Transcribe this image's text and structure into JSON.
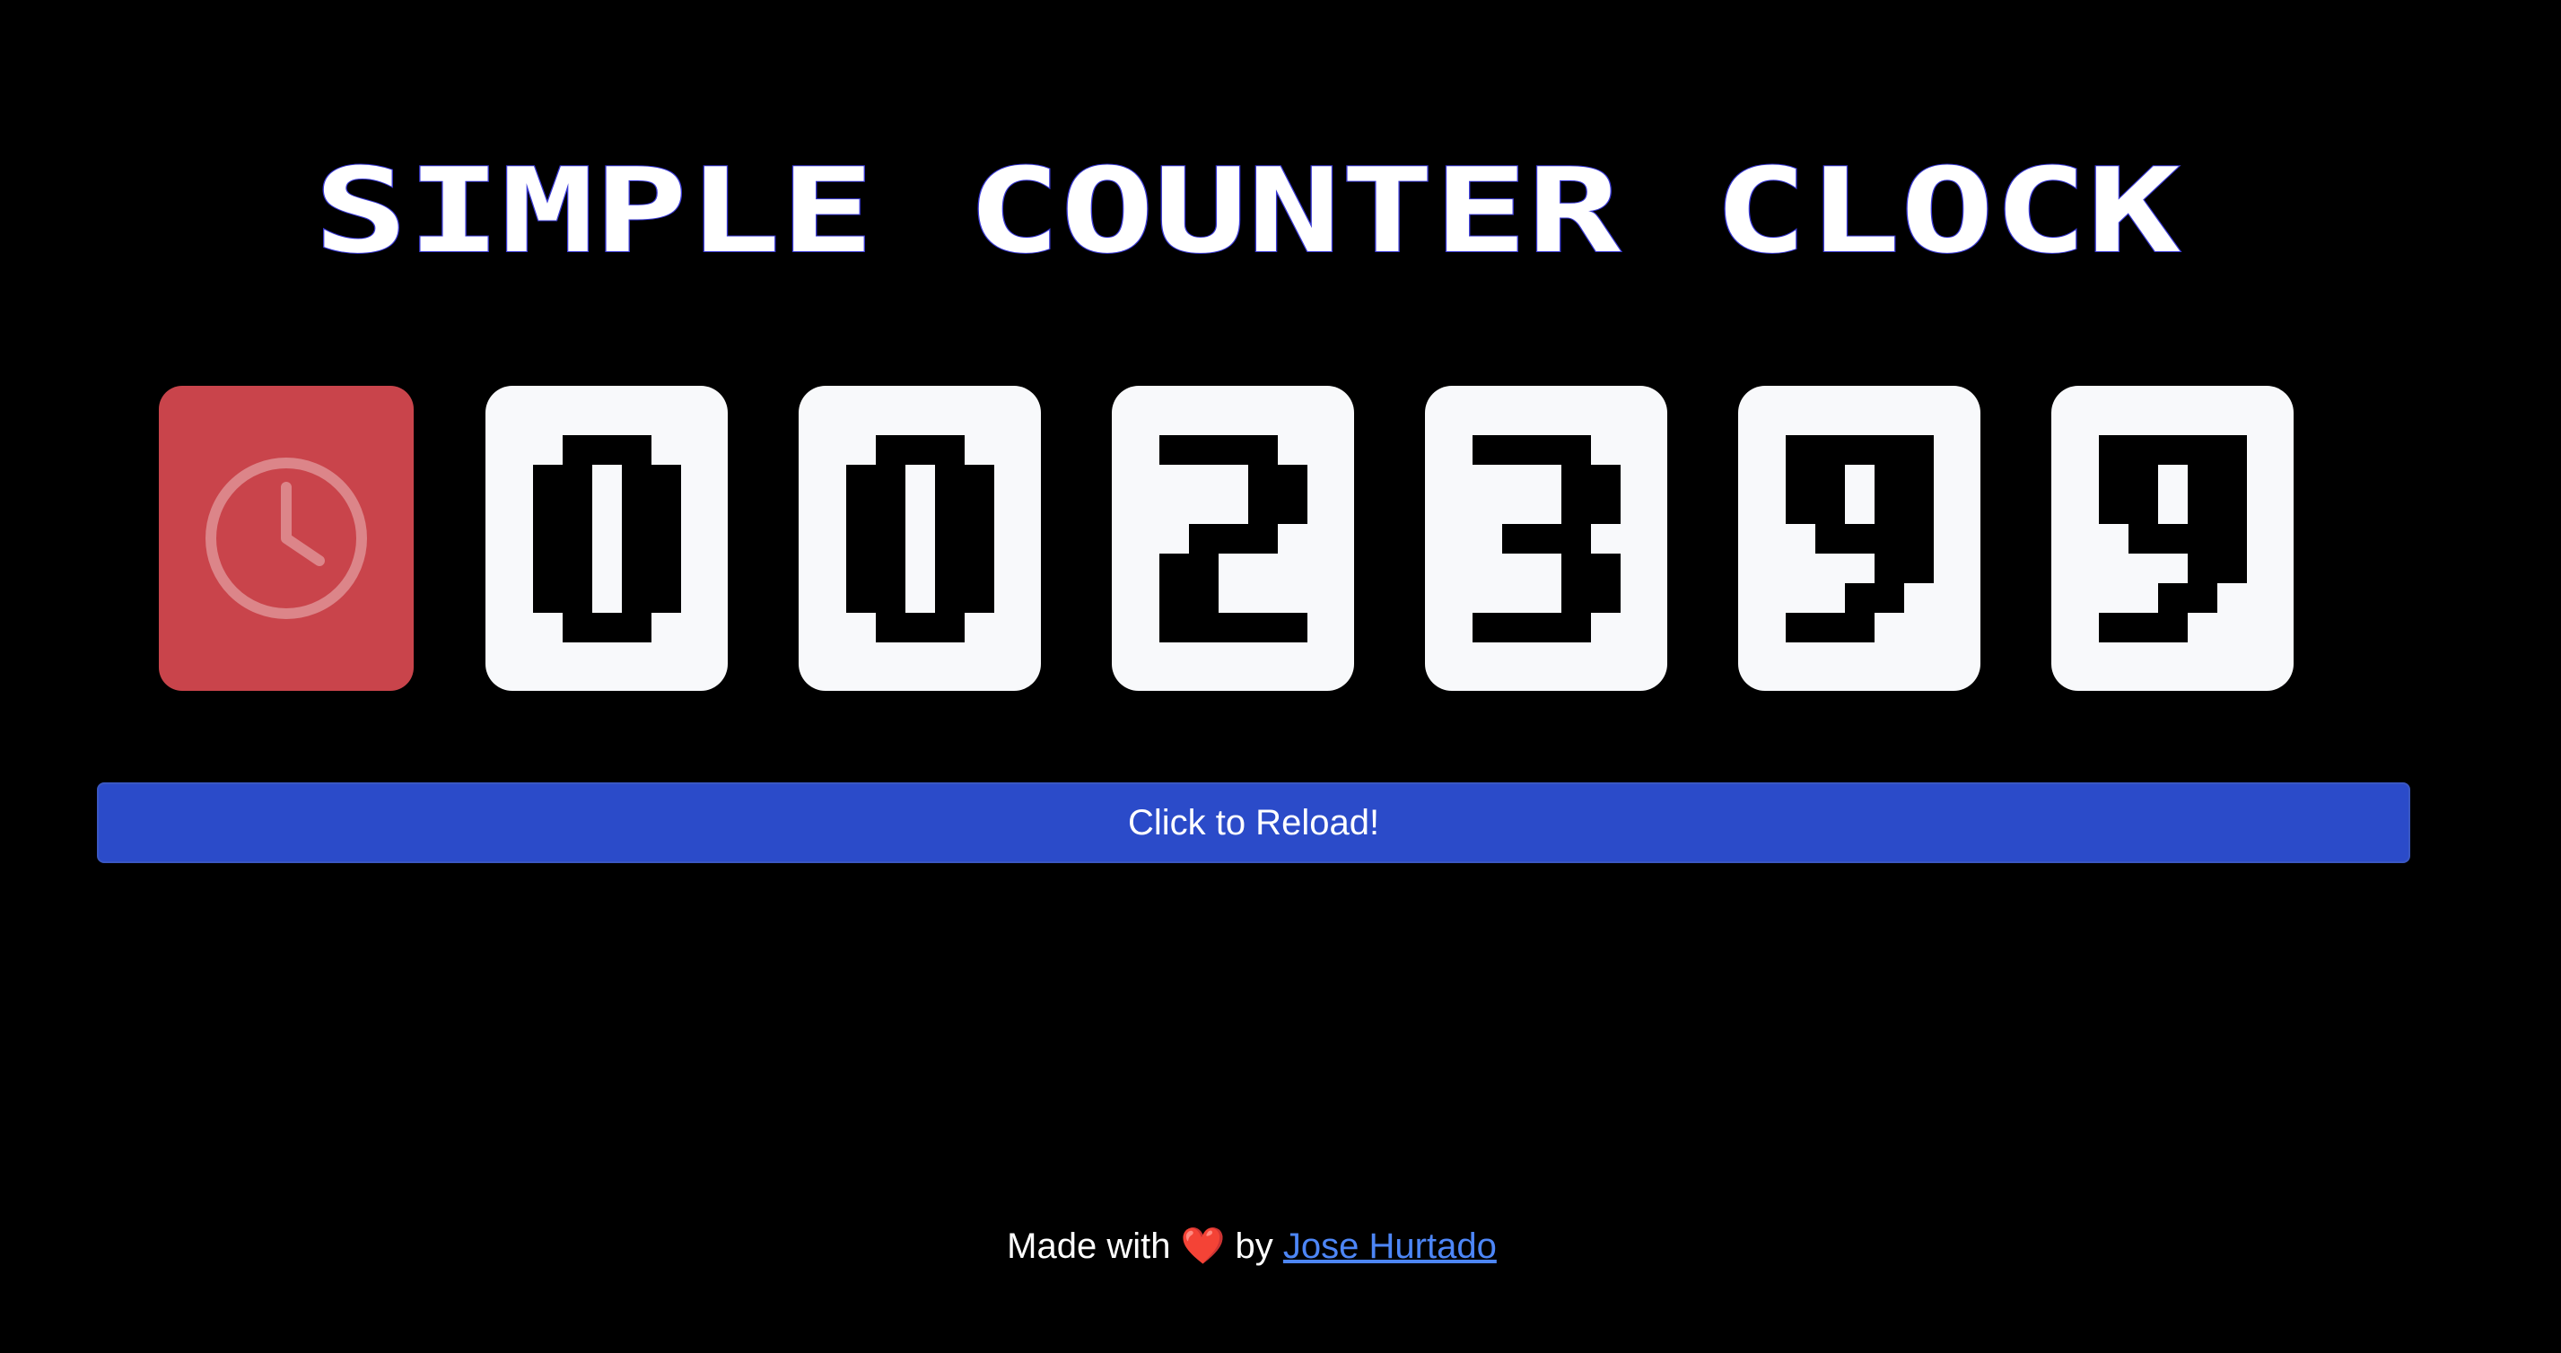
{
  "title": "SIMPLE COUNTER CLOCK",
  "counter": {
    "icon": "clock-icon",
    "digits": [
      "0",
      "0",
      "2",
      "3",
      "9",
      "9"
    ]
  },
  "reload_button": {
    "label": "Click to Reload!"
  },
  "footer": {
    "prefix": "Made with",
    "heart": "❤️",
    "by": "by",
    "author": "Jose Hurtado"
  },
  "colors": {
    "background": "#000000",
    "clock_tile": "#c9444b",
    "digit_tile": "#f8f9fb",
    "button": "#2b4bc9",
    "link": "#4d86f7"
  }
}
